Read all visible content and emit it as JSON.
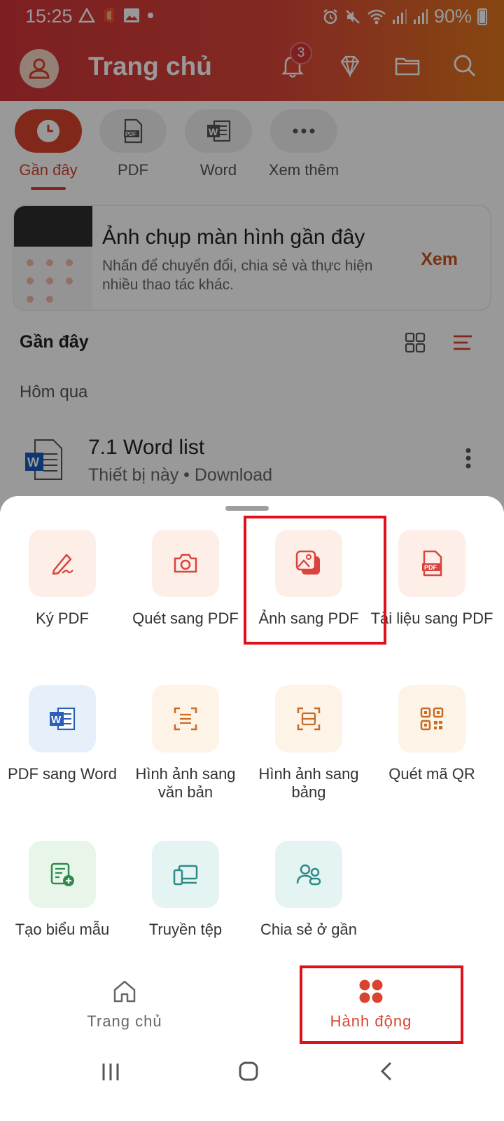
{
  "status_bar": {
    "time": "15:25",
    "battery": "90%"
  },
  "header": {
    "title": "Trang chủ",
    "notification_count": "3"
  },
  "tabs": [
    {
      "label": "Gần đây",
      "icon": "clock-icon",
      "active": true
    },
    {
      "label": "PDF",
      "icon": "pdf-file-icon",
      "active": false
    },
    {
      "label": "Word",
      "icon": "word-icon",
      "active": false
    },
    {
      "label": "Xem thêm",
      "icon": "more-horizontal-icon",
      "active": false
    }
  ],
  "screenshot_card": {
    "title": "Ảnh chụp màn hình gần đây",
    "description": "Nhấn để chuyển đổi, chia sẻ và thực hiện nhiều thao tác khác.",
    "action": "Xem"
  },
  "recent": {
    "section_title": "Gần đây",
    "group_label": "Hôm qua",
    "files": [
      {
        "name": "7.1 Word list",
        "meta": "Thiết bị này • Download",
        "icon": "word-doc-icon"
      }
    ]
  },
  "actions": [
    {
      "label": "Ký PDF",
      "icon": "sign-pen-icon"
    },
    {
      "label": "Quét sang PDF",
      "icon": "camera-icon"
    },
    {
      "label": "Ảnh sang PDF",
      "icon": "image-to-pdf-icon"
    },
    {
      "label": "Tài liệu sang PDF",
      "icon": "document-to-pdf-icon"
    },
    {
      "label": "PDF sang Word",
      "icon": "word-icon"
    },
    {
      "label": "Hình ảnh sang văn bản",
      "icon": "scan-text-icon"
    },
    {
      "label": "Hình ảnh sang bảng",
      "icon": "scan-table-icon"
    },
    {
      "label": "Quét mã QR",
      "icon": "qr-code-icon"
    },
    {
      "label": "Tạo biểu mẫu",
      "icon": "create-form-icon"
    },
    {
      "label": "Truyền tệp",
      "icon": "file-transfer-icon"
    },
    {
      "label": "Chia sẻ ở gần",
      "icon": "nearby-share-icon"
    }
  ],
  "bottom_nav": [
    {
      "label": "Trang chủ",
      "icon": "home-icon",
      "active": false
    },
    {
      "label": "Hành động",
      "icon": "actions-grid-icon",
      "active": true
    }
  ],
  "colors": {
    "accent": "#d9442e",
    "highlight": "#e0111b",
    "header_start": "#d1343a",
    "header_end": "#e0761c"
  }
}
